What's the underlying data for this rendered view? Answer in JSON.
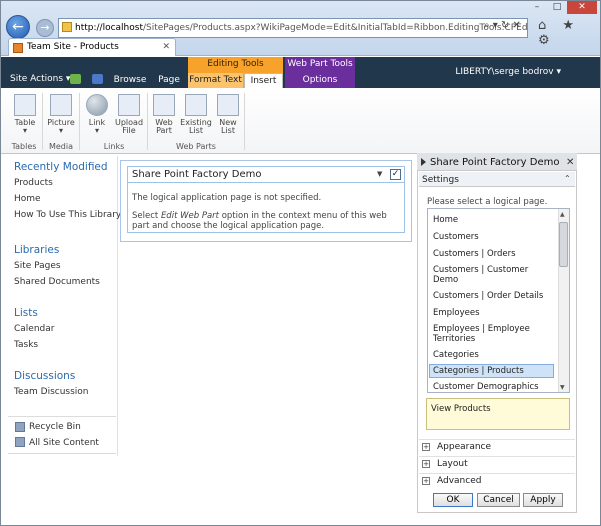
{
  "browser": {
    "address_host": "http://localhost",
    "address_path": "/SitePages/Products.aspx?WikiPageMode=Edit&InitialTabId=Ribbon.EditingTools.CPEditTab&",
    "tab_title": "Team Site - Products",
    "addr_btns": "⌕ ▾ ↻ ✕",
    "icons": "⌂ ★ ⚙",
    "win_min": "–",
    "win_max": "□",
    "win_close": "✕",
    "tab_close": "✕"
  },
  "ribbon": {
    "site_actions": "Site Actions ▾",
    "tabs": {
      "browse": "Browse",
      "page": "Page",
      "format_text": "Format Text",
      "insert": "Insert",
      "options": "Options"
    },
    "contexts": {
      "editing_tools": "Editing Tools",
      "web_part_tools": "Web Part Tools"
    },
    "user": "LIBERTY\\serge bodrov ▾",
    "buttons": {
      "table": "Table",
      "picture": "Picture",
      "link": "Link",
      "upload_1": "Upload",
      "upload_2": "File",
      "webpart_1": "Web",
      "webpart_2": "Part",
      "existing_1": "Existing",
      "existing_2": "List",
      "new_1": "New",
      "new_2": "List"
    },
    "dropdown_arrow": "▾",
    "groups": {
      "tables": "Tables",
      "media": "Media",
      "links": "Links",
      "web_parts": "Web Parts"
    }
  },
  "leftnav": {
    "recently_modified": "Recently Modified",
    "recent_items": [
      "Products",
      "Home",
      "How To Use This Library"
    ],
    "libraries": "Libraries",
    "library_items": [
      "Site Pages",
      "Shared Documents"
    ],
    "lists": "Lists",
    "list_items": [
      "Calendar",
      "Tasks"
    ],
    "discussions": "Discussions",
    "discussion_items": [
      "Team Discussion"
    ],
    "recycle_bin": "Recycle Bin",
    "all_site_content": "All Site Content"
  },
  "webpart": {
    "title": "Share Point Factory Demo",
    "menu_arrow": "▼",
    "check": "✓",
    "line1": "The logical application page is not specified.",
    "line2_a": "Select ",
    "line2_em": "Edit Web Part",
    "line2_b": " option in the context menu of this web part and choose the logical application page."
  },
  "toolpane": {
    "title": "Share Point Factory Demo",
    "close": "✕",
    "settings": "Settings",
    "collapse": "⌃",
    "select_label": "Please select a logical page.",
    "pages": [
      "Home",
      "Customers",
      "Customers | Orders",
      "Customers | Customer Demo",
      "Customers | Order Details",
      "Employees",
      "Employees | Employee Territories",
      "Categories",
      "Categories | Products",
      "Customer Demographics"
    ],
    "selected": "Categories | Products",
    "scroll_up": "▲",
    "scroll_down": "▼",
    "description": "View Products",
    "sections": [
      "Appearance",
      "Layout",
      "Advanced"
    ],
    "plus": "+",
    "ok": "OK",
    "cancel": "Cancel",
    "apply": "Apply"
  }
}
